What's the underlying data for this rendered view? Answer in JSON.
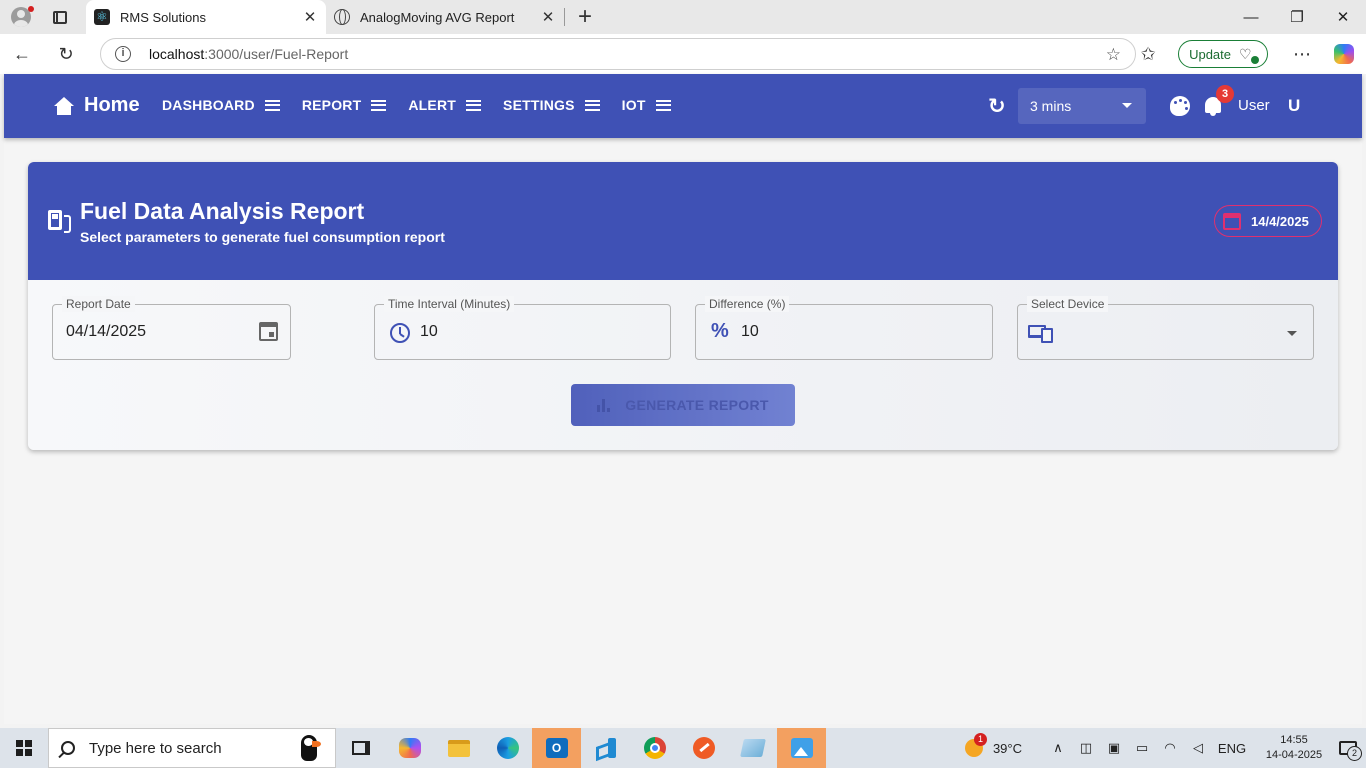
{
  "browser": {
    "tabs": [
      {
        "title": "RMS Solutions",
        "active": true
      },
      {
        "title": "AnalogMoving AVG Report",
        "active": false
      }
    ],
    "url_host": "localhost",
    "url_path": ":3000/user/Fuel-Report",
    "update_label": "Update"
  },
  "appbar": {
    "home_label": "Home",
    "menu": [
      "DASHBOARD",
      "REPORT",
      "ALERT",
      "SETTINGS",
      "IOT"
    ],
    "refresh_interval": "3 mins",
    "notification_count": "3",
    "user_label": "User",
    "avatar_initial": "U"
  },
  "report": {
    "title": "Fuel Data Analysis Report",
    "subtitle": "Select parameters to generate fuel consumption report",
    "date_chip": "14/4/2025",
    "fields": {
      "report_date": {
        "label": "Report Date",
        "value": "04/14/2025"
      },
      "time_interval": {
        "label": "Time Interval (Minutes)",
        "value": "10"
      },
      "difference": {
        "label": "Difference (%)",
        "value": "10"
      },
      "device": {
        "label": "Select Device",
        "value": ""
      }
    },
    "generate_label": "GENERATE REPORT"
  },
  "taskbar": {
    "search_placeholder": "Type here to search",
    "temperature": "39°C",
    "weather_badge": "1",
    "language": "ENG",
    "time": "14:55",
    "date": "14-04-2025",
    "notification_count": "2"
  },
  "colors": {
    "primary": "#3f51b5",
    "accent": "#e0306f",
    "badge": "#e53935"
  }
}
